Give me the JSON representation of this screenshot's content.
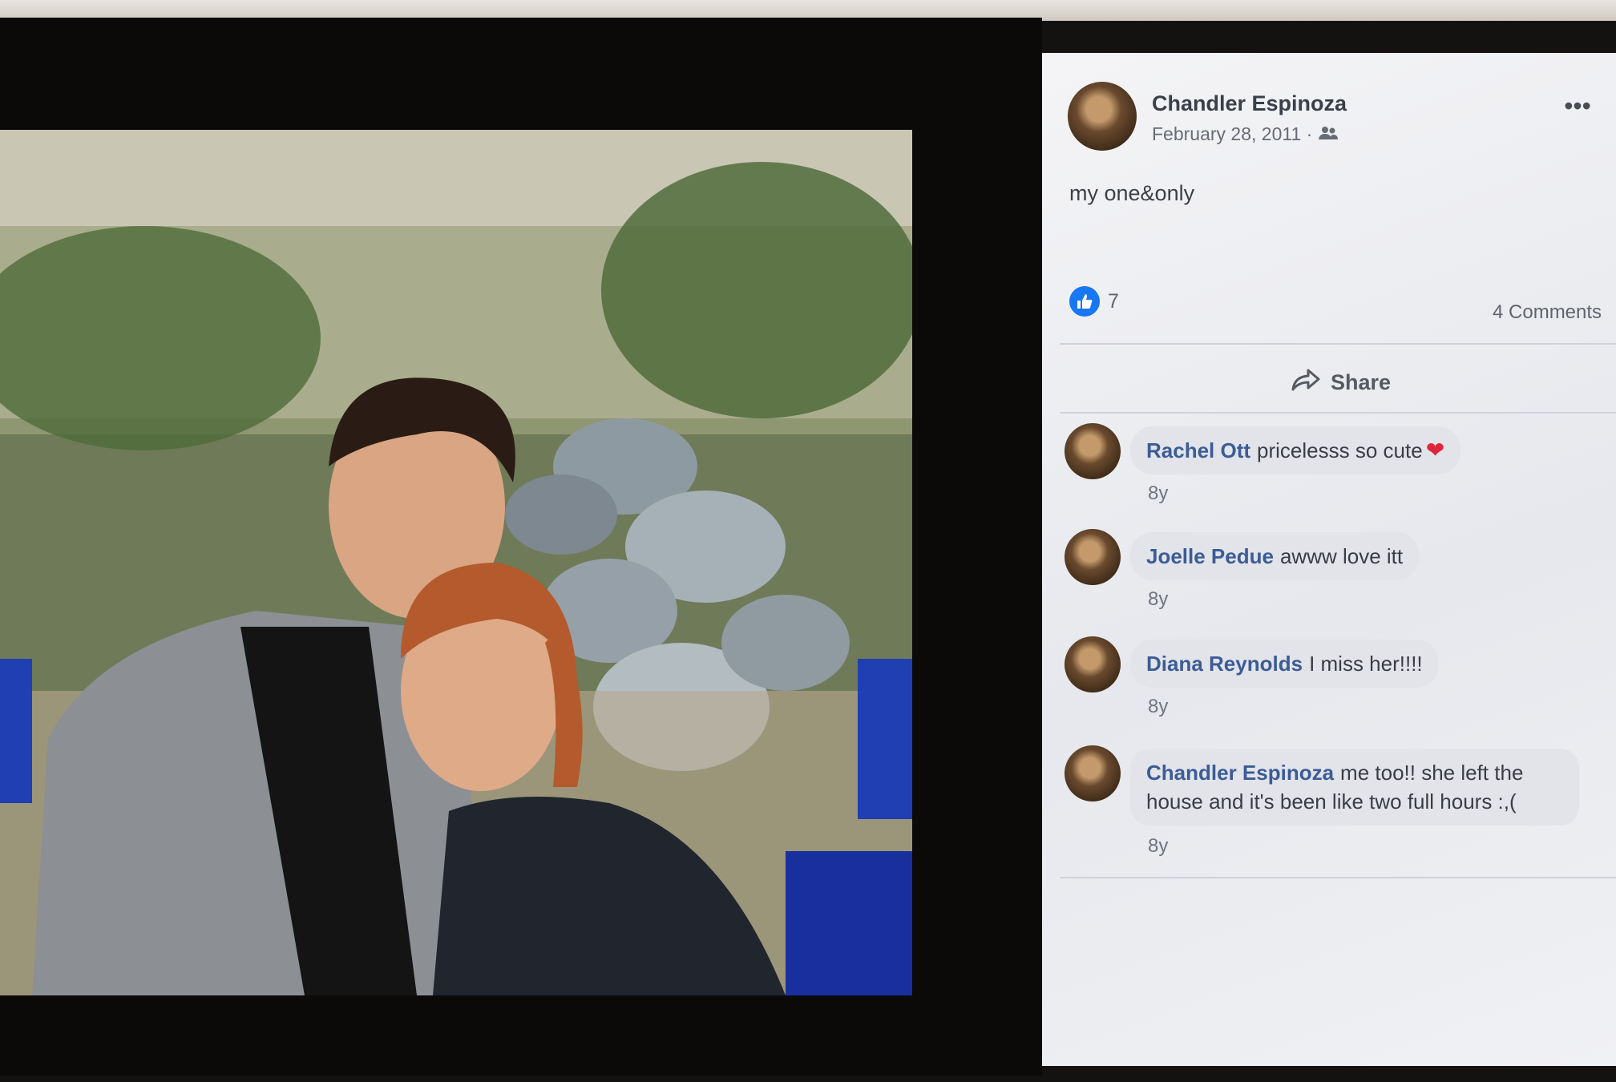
{
  "post": {
    "author": "Chandler Espinoza",
    "date": "February 28, 2011 ·",
    "audience_icon": "friends-icon",
    "text": "my one&only",
    "likes": "7",
    "comments_count": "4 Comments",
    "share_label": "Share"
  },
  "comments": [
    {
      "author": "Rachel Ott",
      "text": "pricelesss so cute",
      "time": "8y",
      "emoji": "❤"
    },
    {
      "author": "Joelle Pedue",
      "text": "awww love itt",
      "time": "8y"
    },
    {
      "author": "Diana Reynolds",
      "text": "I miss her!!!!",
      "time": "8y"
    },
    {
      "author": "Chandler Espinoza",
      "text": "me too!! she left the house and it's been like two full hours :,(",
      "time": "8y"
    }
  ],
  "colors": {
    "like_blue": "#1877f2",
    "name_blue": "#3b5c96",
    "heart_red": "#e0263b"
  }
}
